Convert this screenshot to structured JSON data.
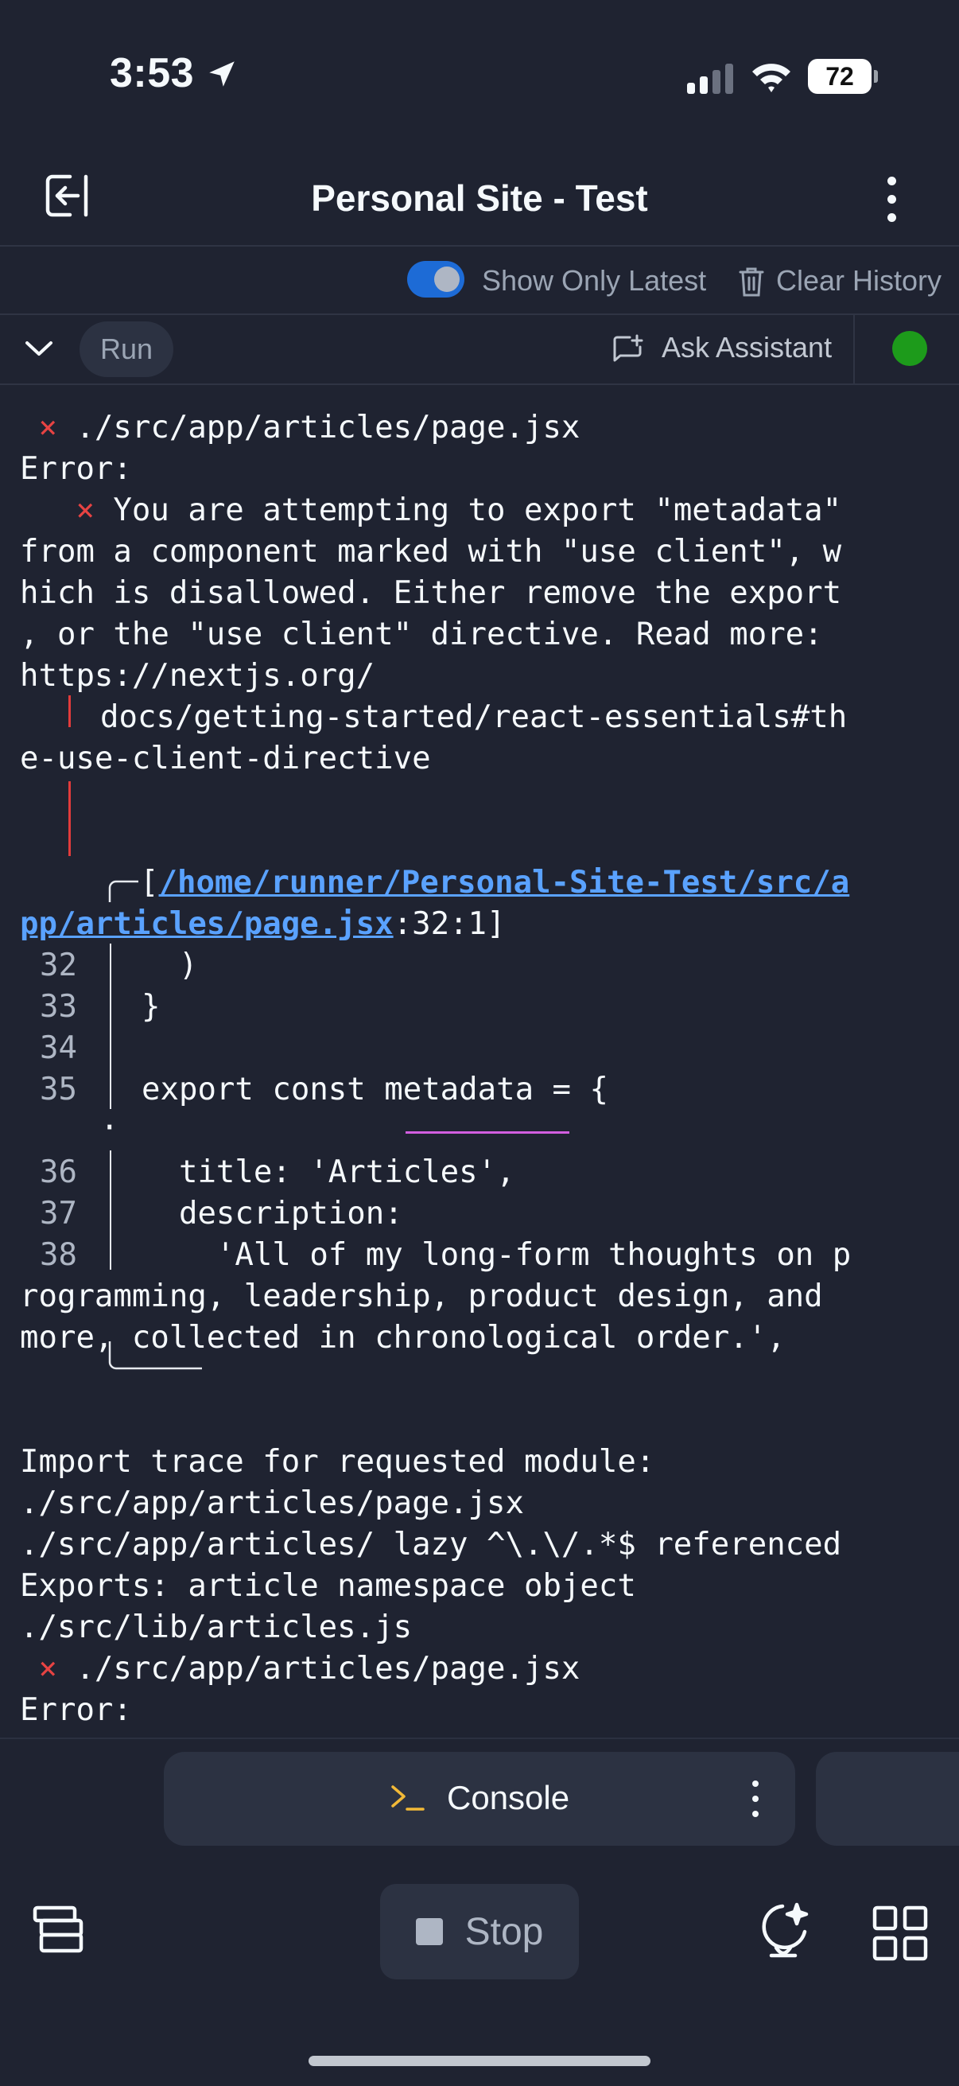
{
  "status_bar": {
    "time": "3:53",
    "battery": "72"
  },
  "header": {
    "title": "Personal Site - Test"
  },
  "console_options": {
    "toggle_label": "Show Only Latest",
    "toggle_on": true,
    "clear_history_label": "Clear History"
  },
  "run_bar": {
    "run_label": "Run",
    "ask_assistant_label": "Ask Assistant",
    "status_color": "#1d9b1b"
  },
  "console": {
    "lines": [
      {
        "x": "×",
        "t": " ./src/app/articles/page.jsx"
      },
      {
        "t": "Error:"
      },
      {
        "x": "×",
        "t": " You are attempting to export \"metadata\""
      },
      {
        "t": "from a component marked with \"use client\", w"
      },
      {
        "t": "hich is disallowed. Either remove the export"
      },
      {
        "t": ", or the \"use client\" directive. Read more:"
      },
      {
        "t": "https://nextjs.org/"
      },
      {
        "t": "docs/getting-started/react-essentials#th"
      },
      {
        "t": "e-use-client-directive"
      },
      {
        "pre": "[",
        "link": "/home/runner/Personal-Site-Test/src/a"
      },
      {
        "link": "pp/articles/page.jsx",
        "post": ":32:1]"
      },
      {
        "n": "32",
        "t": "  )"
      },
      {
        "n": "33",
        "t": "}"
      },
      {
        "n": "34",
        "t": ""
      },
      {
        "n": "35",
        "t": "export const metadata = {"
      },
      {
        "t": "·"
      },
      {
        "n": "36",
        "t": "  title: 'Articles',"
      },
      {
        "n": "37",
        "t": "  description:"
      },
      {
        "n": "38",
        "t": "    'All of my long-form thoughts on p"
      },
      {
        "t": "rogramming, leadership, product design, and"
      },
      {
        "t": "more, collected in chronological order.',"
      },
      {
        "t": "Import trace for requested module:"
      },
      {
        "t": "./src/app/articles/page.jsx"
      },
      {
        "t": "./src/app/articles/ lazy ^\\.\\/.*$ referenced"
      },
      {
        "t": "Exports: article namespace object"
      },
      {
        "t": "./src/lib/articles.js"
      },
      {
        "x": "×",
        "t": " ./src/app/articles/page.jsx"
      },
      {
        "t": "Error:"
      }
    ]
  },
  "bottom_bar": {
    "console_tab_label": "Console",
    "stop_label": "Stop"
  },
  "colors": {
    "background": "#1f2331",
    "error": "#e74343",
    "link": "#5aa2ff",
    "accent": "#1d6bd6"
  }
}
